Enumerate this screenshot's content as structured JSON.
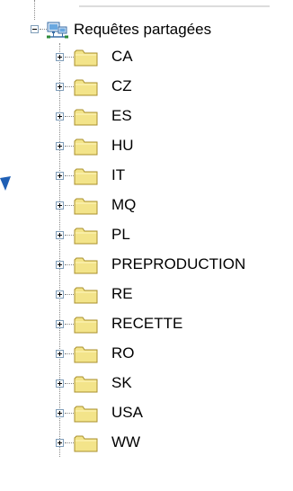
{
  "root": {
    "label": "Requêtes partagées",
    "icon": "network-share-icon"
  },
  "items": [
    {
      "label": "CA"
    },
    {
      "label": "CZ"
    },
    {
      "label": "ES"
    },
    {
      "label": "HU"
    },
    {
      "label": "IT"
    },
    {
      "label": "MQ"
    },
    {
      "label": "PL"
    },
    {
      "label": "PREPRODUCTION"
    },
    {
      "label": "RE"
    },
    {
      "label": "RECETTE"
    },
    {
      "label": "RO"
    },
    {
      "label": "SK"
    },
    {
      "label": "USA"
    },
    {
      "label": "WW"
    }
  ],
  "colors": {
    "folder_fill": "#f3e48a",
    "folder_border": "#a88f2c",
    "expander_border": "#7f9db9",
    "cursor": "#1f5fb5"
  }
}
